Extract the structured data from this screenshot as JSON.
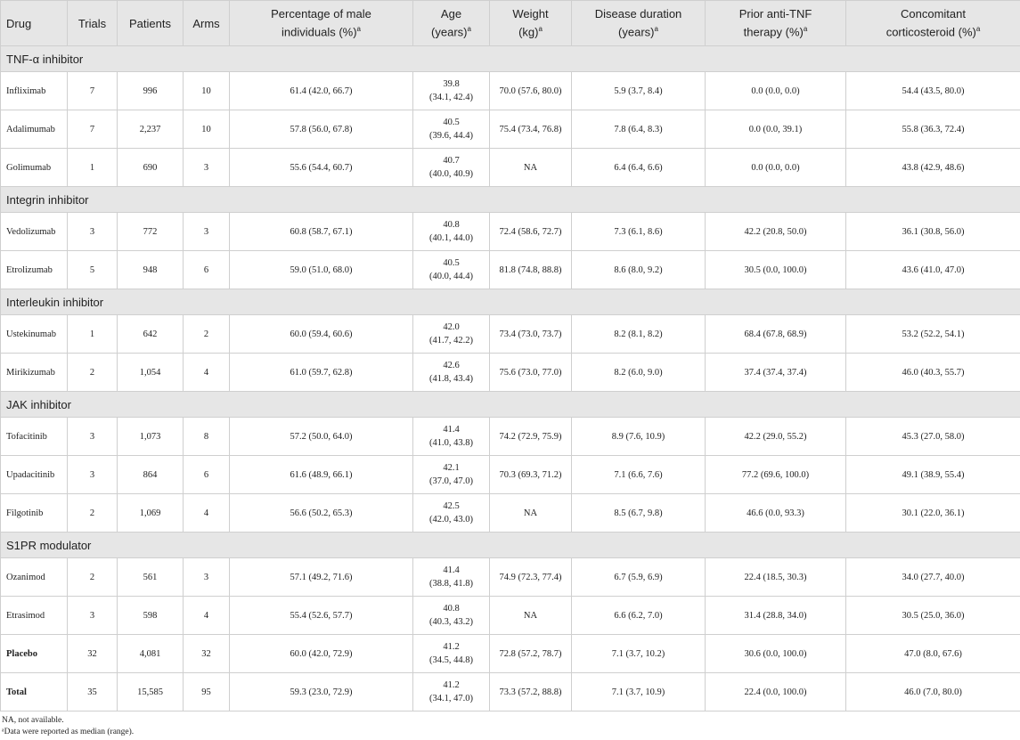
{
  "headers": [
    "Drug",
    "Trials",
    "Patients",
    "Arms",
    "Percentage of male individuals (%)",
    "Age (years)",
    "Weight (kg)",
    "Disease duration (years)",
    "Prior anti-TNF therapy (%)",
    "Concomitant corticosteroid (%)"
  ],
  "header_lines": [
    [
      "Drug"
    ],
    [
      "Trials"
    ],
    [
      "Patients"
    ],
    [
      "Arms"
    ],
    [
      "Percentage of male",
      "individuals (%)"
    ],
    [
      "Age",
      "(years)"
    ],
    [
      "Weight",
      "(kg)"
    ],
    [
      "Disease duration",
      "(years)"
    ],
    [
      "Prior anti-TNF",
      "therapy (%)"
    ],
    [
      "Concomitant",
      "corticosteroid (%)"
    ]
  ],
  "header_marker": "a",
  "groups": [
    {
      "label": "TNF-α inhibitor",
      "rows": [
        [
          "Infliximab",
          "7",
          "996",
          "10",
          "61.4 (42.0, 66.7)",
          "39.8 (34.1, 42.4)",
          "70.0 (57.6, 80.0)",
          "5.9 (3.7, 8.4)",
          "0.0 (0.0, 0.0)",
          "54.4 (43.5, 80.0)"
        ],
        [
          "Adalimumab",
          "7",
          "2,237",
          "10",
          "57.8 (56.0, 67.8)",
          "40.5 (39.6, 44.4)",
          "75.4 (73.4, 76.8)",
          "7.8 (6.4, 8.3)",
          "0.0 (0.0, 39.1)",
          "55.8 (36.3, 72.4)"
        ],
        [
          "Golimumab",
          "1",
          "690",
          "3",
          "55.6 (54.4, 60.7)",
          "40.7 (40.0, 40.9)",
          "NA",
          "6.4 (6.4, 6.6)",
          "0.0 (0.0, 0.0)",
          "43.8 (42.9, 48.6)"
        ]
      ]
    },
    {
      "label": "Integrin inhibitor",
      "rows": [
        [
          "Vedolizumab",
          "3",
          "772",
          "3",
          "60.8 (58.7, 67.1)",
          "40.8 (40.1, 44.0)",
          "72.4 (58.6, 72.7)",
          "7.3 (6.1, 8.6)",
          "42.2 (20.8, 50.0)",
          "36.1 (30.8, 56.0)"
        ],
        [
          "Etrolizumab",
          "5",
          "948",
          "6",
          "59.0 (51.0, 68.0)",
          "40.5 (40.0, 44.4)",
          "81.8 (74.8, 88.8)",
          "8.6 (8.0, 9.2)",
          "30.5 (0.0, 100.0)",
          "43.6 (41.0, 47.0)"
        ]
      ]
    },
    {
      "label": "Interleukin inhibitor",
      "rows": [
        [
          "Ustekinumab",
          "1",
          "642",
          "2",
          "60.0 (59.4, 60.6)",
          "42.0 (41.7, 42.2)",
          "73.4 (73.0, 73.7)",
          "8.2 (8.1, 8.2)",
          "68.4 (67.8, 68.9)",
          "53.2 (52.2, 54.1)"
        ],
        [
          "Mirikizumab",
          "2",
          "1,054",
          "4",
          "61.0 (59.7, 62.8)",
          "42.6 (41.8, 43.4)",
          "75.6 (73.0, 77.0)",
          "8.2 (6.0, 9.0)",
          "37.4 (37.4, 37.4)",
          "46.0 (40.3, 55.7)"
        ]
      ]
    },
    {
      "label": "JAK inhibitor",
      "rows": [
        [
          "Tofacitinib",
          "3",
          "1,073",
          "8",
          "57.2 (50.0, 64.0)",
          "41.4 (41.0, 43.8)",
          "74.2 (72.9, 75.9)",
          "8.9 (7.6, 10.9)",
          "42.2 (29.0, 55.2)",
          "45.3 (27.0, 58.0)"
        ],
        [
          "Upadacitinib",
          "3",
          "864",
          "6",
          "61.6 (48.9, 66.1)",
          "42.1 (37.0, 47.0)",
          "70.3 (69.3, 71.2)",
          "7.1 (6.6, 7.6)",
          "77.2 (69.6, 100.0)",
          "49.1 (38.9, 55.4)"
        ],
        [
          "Filgotinib",
          "2",
          "1,069",
          "4",
          "56.6 (50.2, 65.3)",
          "42.5 (42.0, 43.0)",
          "NA",
          "8.5 (6.7, 9.8)",
          "46.6 (0.0, 93.3)",
          "30.1 (22.0, 36.1)"
        ]
      ]
    },
    {
      "label": "S1PR modulator",
      "rows": [
        [
          "Ozanimod",
          "2",
          "561",
          "3",
          "57.1 (49.2, 71.6)",
          "41.4 (38.8, 41.8)",
          "74.9 (72.3, 77.4)",
          "6.7 (5.9, 6.9)",
          "22.4 (18.5, 30.3)",
          "34.0 (27.7, 40.0)"
        ],
        [
          "Etrasimod",
          "3",
          "598",
          "4",
          "55.4 (52.6, 57.7)",
          "40.8 (40.3, 43.2)",
          "NA",
          "6.6 (6.2, 7.0)",
          "31.4 (28.8, 34.0)",
          "30.5 (25.0, 36.0)"
        ]
      ]
    }
  ],
  "summary_rows": [
    [
      "Placebo",
      "32",
      "4,081",
      "32",
      "60.0 (42.0, 72.9)",
      "41.2 (34.5, 44.8)",
      "72.8 (57.2, 78.7)",
      "7.1 (3.7, 10.2)",
      "30.6 (0.0, 100.0)",
      "47.0 (8.0, 67.6)"
    ],
    [
      "Total",
      "35",
      "15,585",
      "95",
      "59.3 (23.0, 72.9)",
      "41.2 (34.1, 47.0)",
      "73.3 (57.2, 88.8)",
      "7.1 (3.7, 10.9)",
      "22.4 (0.0, 100.0)",
      "46.0 (7.0, 80.0)"
    ]
  ],
  "footnotes": [
    "NA, not available.",
    "ᵃData were reported as median (range)."
  ]
}
